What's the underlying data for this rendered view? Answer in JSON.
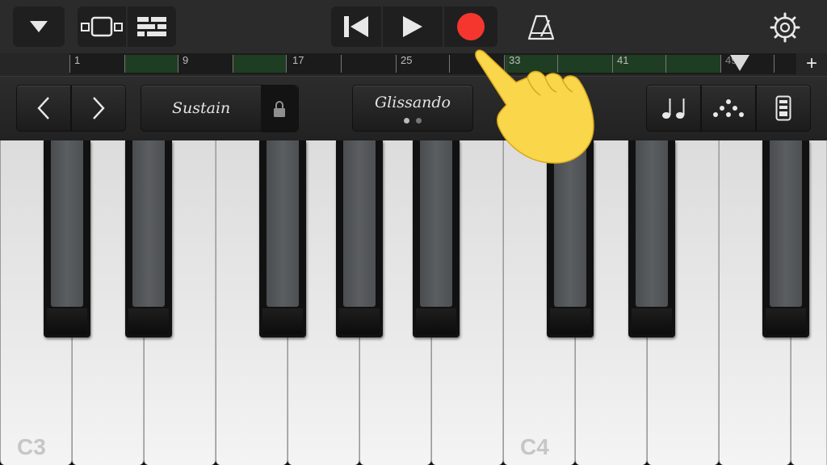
{
  "app": {
    "accent_record": "#f5362f",
    "region_color": "#1f3d23"
  },
  "toolbar": {
    "browser_icon": "triangle-down-icon",
    "tracks_view_icon": "tracks-view-icon",
    "mixer_icon": "mixer-icon",
    "rewind_icon": "go-to-beginning-icon",
    "play_icon": "play-icon",
    "record_icon": "record-icon",
    "metronome_icon": "metronome-icon",
    "settings_icon": "gear-icon"
  },
  "ruler": {
    "bars": [
      "1",
      "9",
      "17",
      "25",
      "33",
      "41",
      "49"
    ],
    "add_label": "+"
  },
  "controls": {
    "prev_label": "<",
    "next_label": ">",
    "sustain_label": "Sustain",
    "glissando_label": "Glissando",
    "arpeggiator_icon": "notes-icon",
    "chord_icon": "scale-dots-icon",
    "settings_icon": "keyboard-settings-icon"
  },
  "keyboard": {
    "c3_label": "C3",
    "c4_label": "C4"
  },
  "overlay": {
    "pointer_icon": "pointing-hand-icon"
  }
}
